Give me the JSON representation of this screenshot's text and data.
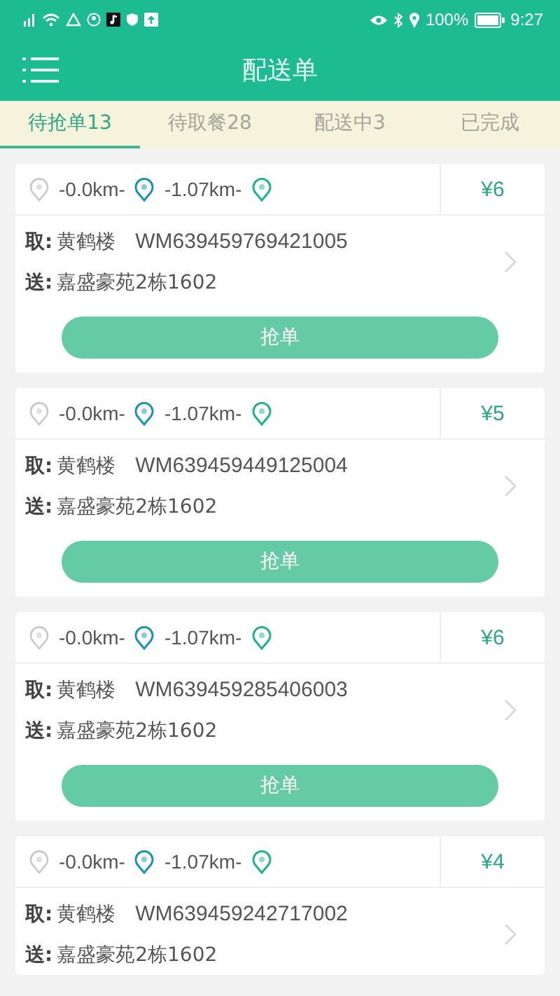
{
  "status_bar": {
    "battery_text": "100%",
    "time": "9:27"
  },
  "header": {
    "title": "配送单"
  },
  "tabs": [
    {
      "label": "待抢单13",
      "selected": true
    },
    {
      "label": "待取餐28",
      "selected": false
    },
    {
      "label": "配送中3",
      "selected": false
    },
    {
      "label": "已完成",
      "selected": false
    }
  ],
  "orders": [
    {
      "dist1": "-0.0km-",
      "dist2": "-1.07km-",
      "price": "¥6",
      "pickup_label": "取:",
      "pickup": "黄鹤楼",
      "order_no": "WM639459769421005",
      "deliver_label": "送:",
      "deliver": "嘉盛豪苑2栋1602",
      "button": "抢单"
    },
    {
      "dist1": "-0.0km-",
      "dist2": "-1.07km-",
      "price": "¥5",
      "pickup_label": "取:",
      "pickup": "黄鹤楼",
      "order_no": "WM639459449125004",
      "deliver_label": "送:",
      "deliver": "嘉盛豪苑2栋1602",
      "button": "抢单"
    },
    {
      "dist1": "-0.0km-",
      "dist2": "-1.07km-",
      "price": "¥6",
      "pickup_label": "取:",
      "pickup": "黄鹤楼",
      "order_no": "WM639459285406003",
      "deliver_label": "送:",
      "deliver": "嘉盛豪苑2栋1602",
      "button": "抢单"
    },
    {
      "dist1": "-0.0km-",
      "dist2": "-1.07km-",
      "price": "¥4",
      "pickup_label": "取:",
      "pickup": "黄鹤楼",
      "order_no": "WM639459242717002",
      "deliver_label": "送:",
      "deliver": "嘉盛豪苑2栋1602"
    }
  ]
}
